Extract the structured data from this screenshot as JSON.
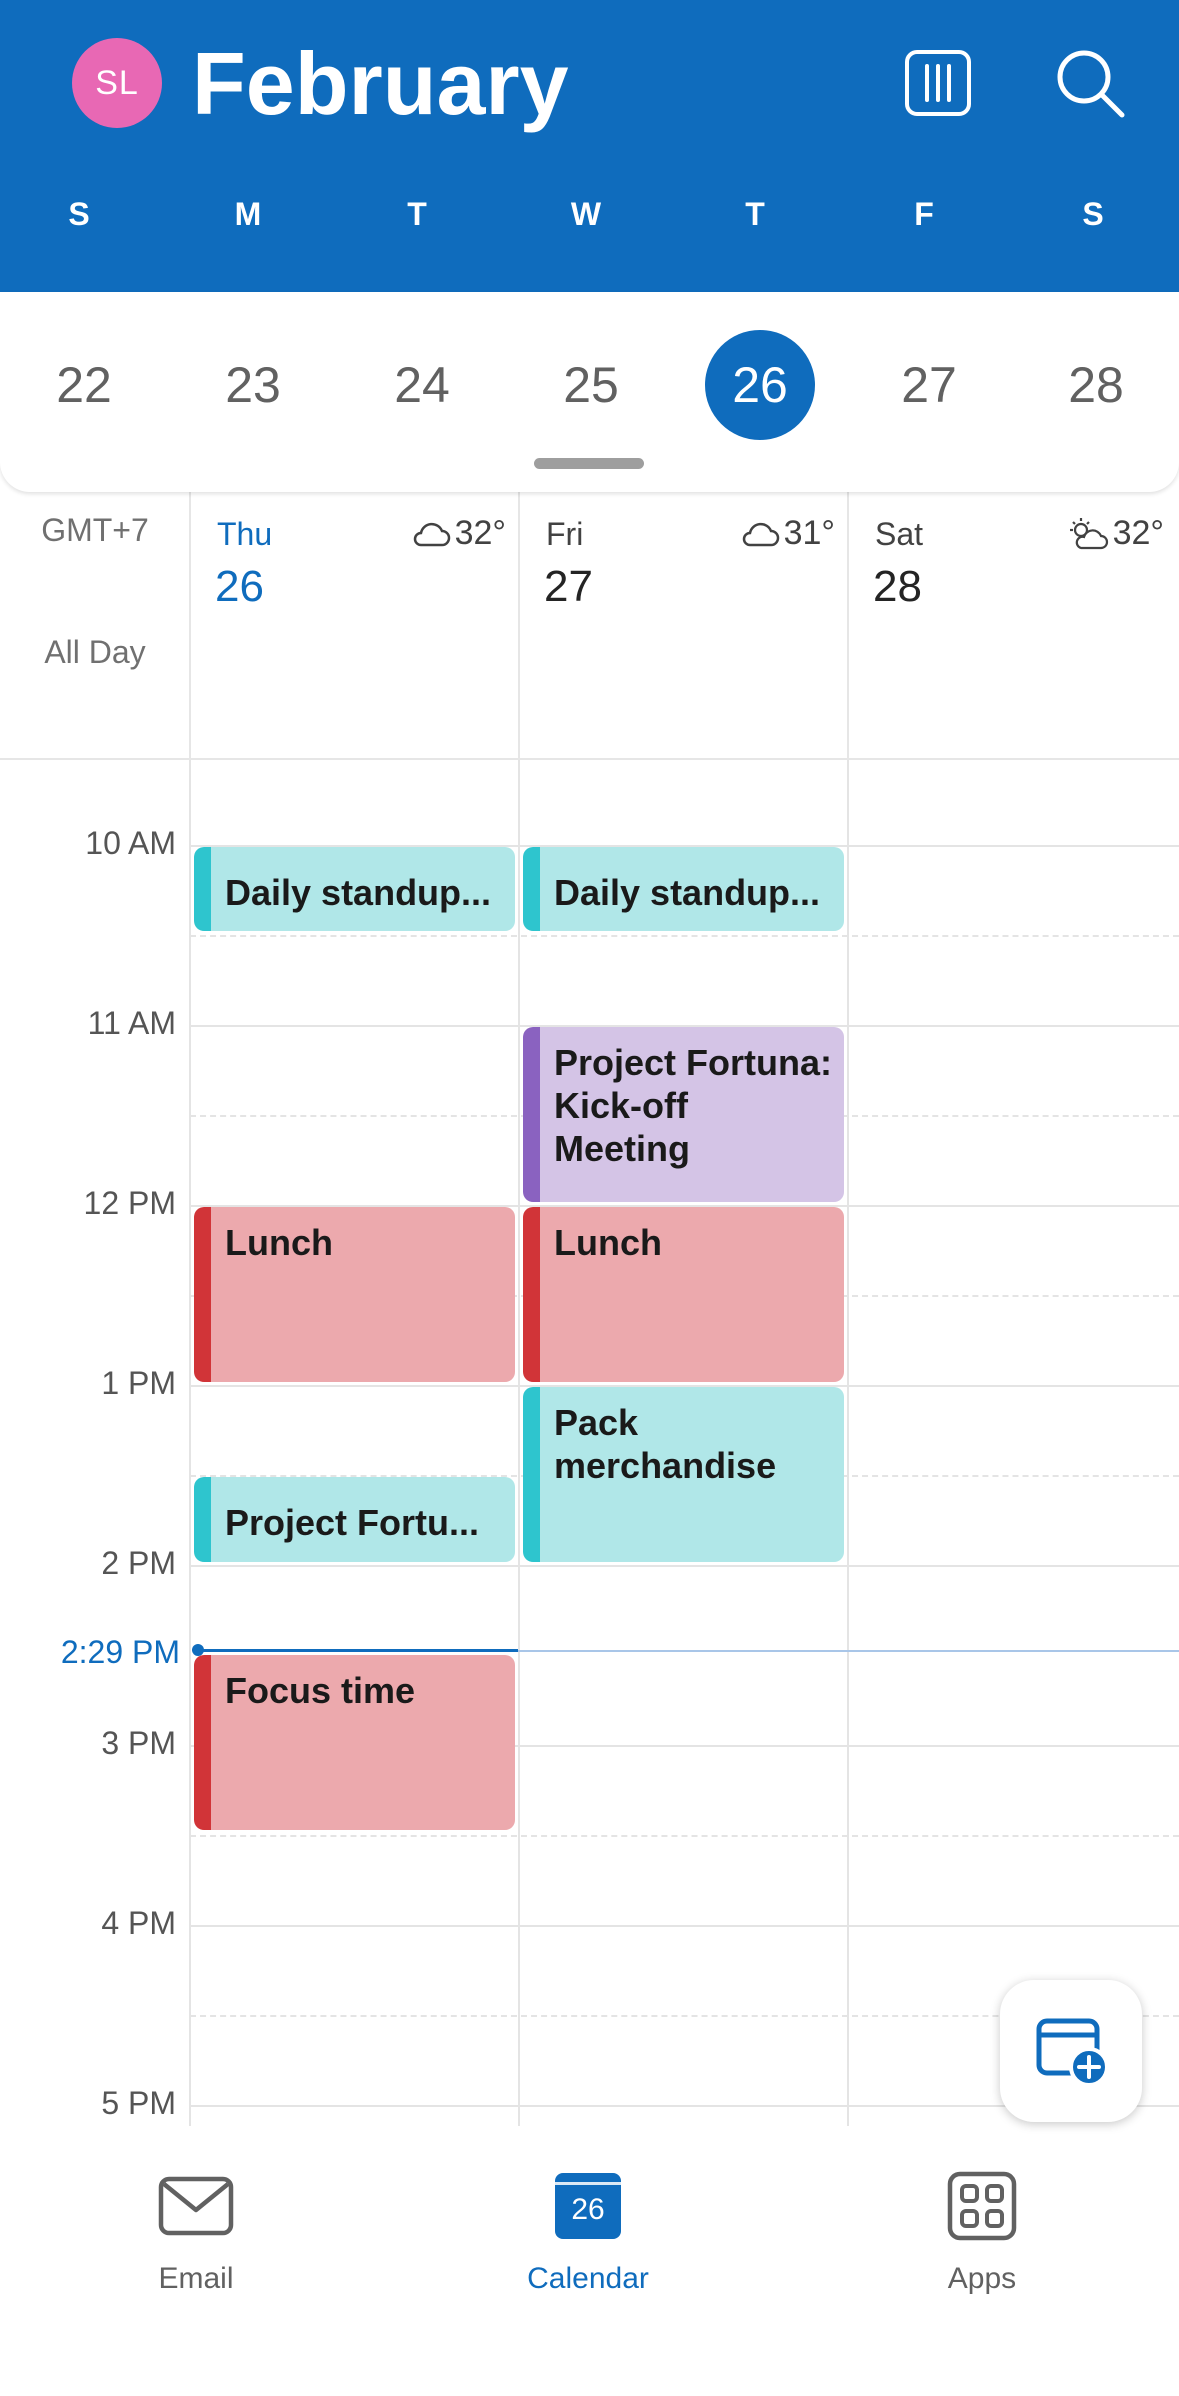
{
  "header": {
    "avatar_initials": "SL",
    "month": "February",
    "weekdays": [
      "S",
      "M",
      "T",
      "W",
      "T",
      "F",
      "S"
    ],
    "dates": [
      "22",
      "23",
      "24",
      "25",
      "26",
      "27",
      "28"
    ],
    "selected_date": "26",
    "colors": {
      "brand": "#0f6cbd",
      "avatar": "#e868b4"
    }
  },
  "timezone": "GMT+7",
  "all_day_label": "All Day",
  "days": [
    {
      "name": "Thu",
      "num": "26",
      "weather_icon": "cloud-icon",
      "temp": "32°",
      "today": true
    },
    {
      "name": "Fri",
      "num": "27",
      "weather_icon": "cloud-icon",
      "temp": "31°",
      "today": false
    },
    {
      "name": "Sat",
      "num": "28",
      "weather_icon": "partly-sunny-icon",
      "temp": "32°",
      "today": false
    }
  ],
  "hours": [
    "10 AM",
    "11 AM",
    "12 PM",
    "1 PM",
    "2 PM",
    "3 PM",
    "4 PM",
    "5 PM"
  ],
  "now": {
    "label": "2:29 PM"
  },
  "events": [
    {
      "day": "Thu",
      "title": "Daily standup...",
      "color": "teal"
    },
    {
      "day": "Fri",
      "title": "Daily standup...",
      "color": "teal"
    },
    {
      "day": "Fri",
      "title": "Project Fortuna: Kick-off Meeting",
      "color": "purple"
    },
    {
      "day": "Thu",
      "title": "Lunch",
      "color": "red"
    },
    {
      "day": "Fri",
      "title": "Lunch",
      "color": "red"
    },
    {
      "day": "Fri",
      "title": "Pack merchandise",
      "color": "teal"
    },
    {
      "day": "Thu",
      "title": "Project Fortu...",
      "color": "teal"
    },
    {
      "day": "Thu",
      "title": "Focus time",
      "color": "red"
    }
  ],
  "nav": {
    "email": "Email",
    "calendar": "Calendar",
    "calendar_icon_day": "26",
    "apps": "Apps"
  }
}
